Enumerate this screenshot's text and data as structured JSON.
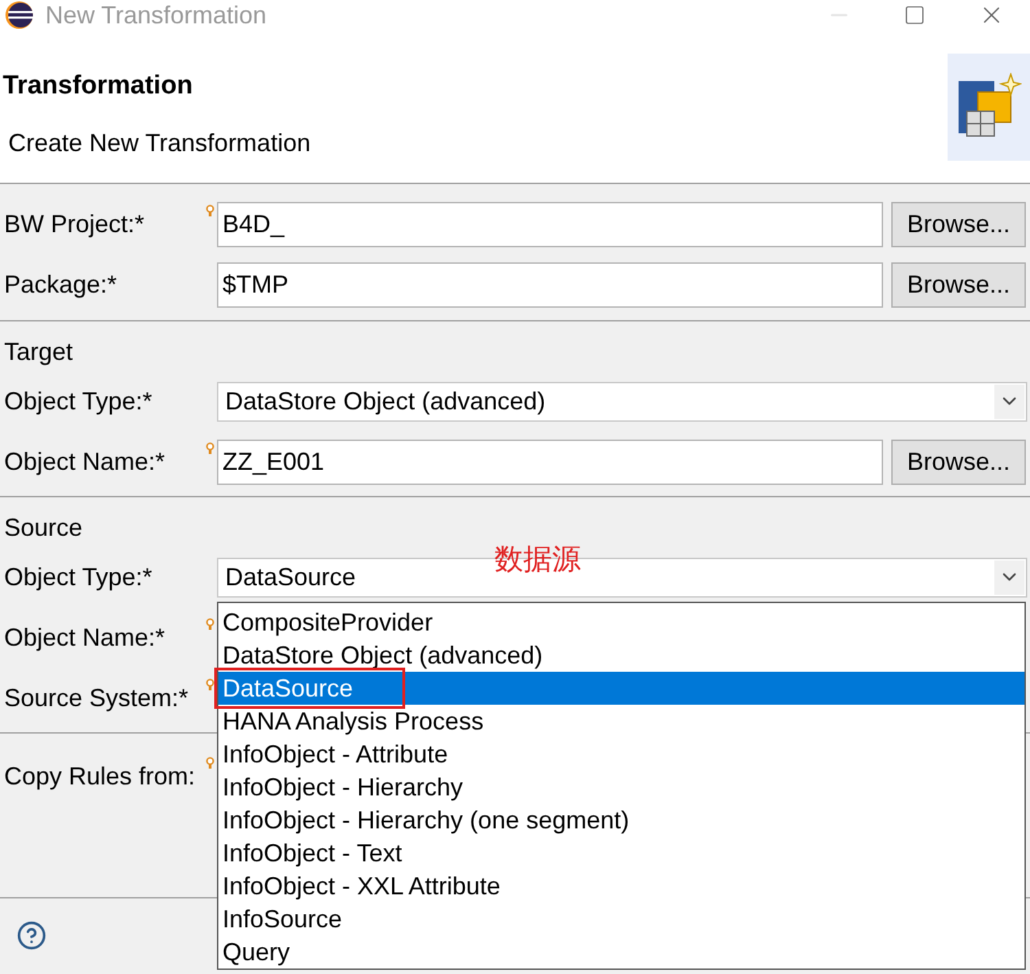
{
  "window": {
    "title": "New Transformation"
  },
  "header": {
    "title": "Transformation",
    "subtitle": "Create New Transformation"
  },
  "general": [
    {
      "label": "BW Project:*",
      "kind": "text",
      "value": "B4D_",
      "button": "Browse...",
      "assist": true
    },
    {
      "label": "Package:*",
      "kind": "text",
      "value": "$TMP",
      "button": "Browse...",
      "assist": false
    }
  ],
  "target": {
    "heading": "Target",
    "fields": [
      {
        "label": "Object Type:*",
        "kind": "combo",
        "value": "DataStore Object (advanced)",
        "assist": false
      },
      {
        "label": "Object Name:*",
        "kind": "text",
        "value": "ZZ_E001",
        "button": "Browse...",
        "assist": true
      }
    ]
  },
  "source": {
    "heading": "Source",
    "fields": [
      {
        "label": "Object Type:*",
        "kind": "combo",
        "value": "DataSource",
        "assist": false
      },
      {
        "label": "Object Name:*",
        "kind": "covered",
        "assist": true
      },
      {
        "label": "Source System:*",
        "kind": "covered",
        "assist": true
      }
    ]
  },
  "copy_rules": {
    "label": "Copy Rules from:",
    "assist": true
  },
  "dropdown": {
    "options": [
      {
        "label": "CompositeProvider",
        "selected": false,
        "boxed": false
      },
      {
        "label": "DataStore Object (advanced)",
        "selected": false,
        "boxed": false
      },
      {
        "label": "DataSource",
        "selected": true,
        "boxed": true
      },
      {
        "label": "HANA Analysis Process",
        "selected": false,
        "boxed": false
      },
      {
        "label": "InfoObject - Attribute",
        "selected": false,
        "boxed": false
      },
      {
        "label": "InfoObject - Hierarchy",
        "selected": false,
        "boxed": false
      },
      {
        "label": "InfoObject - Hierarchy (one segment)",
        "selected": false,
        "boxed": false
      },
      {
        "label": "InfoObject - Text",
        "selected": false,
        "boxed": false
      },
      {
        "label": "InfoObject - XXL Attribute",
        "selected": false,
        "boxed": false
      },
      {
        "label": "InfoSource",
        "selected": false,
        "boxed": false
      },
      {
        "label": "Query",
        "selected": false,
        "boxed": false
      }
    ]
  },
  "annotation": {
    "text": "数据源"
  }
}
